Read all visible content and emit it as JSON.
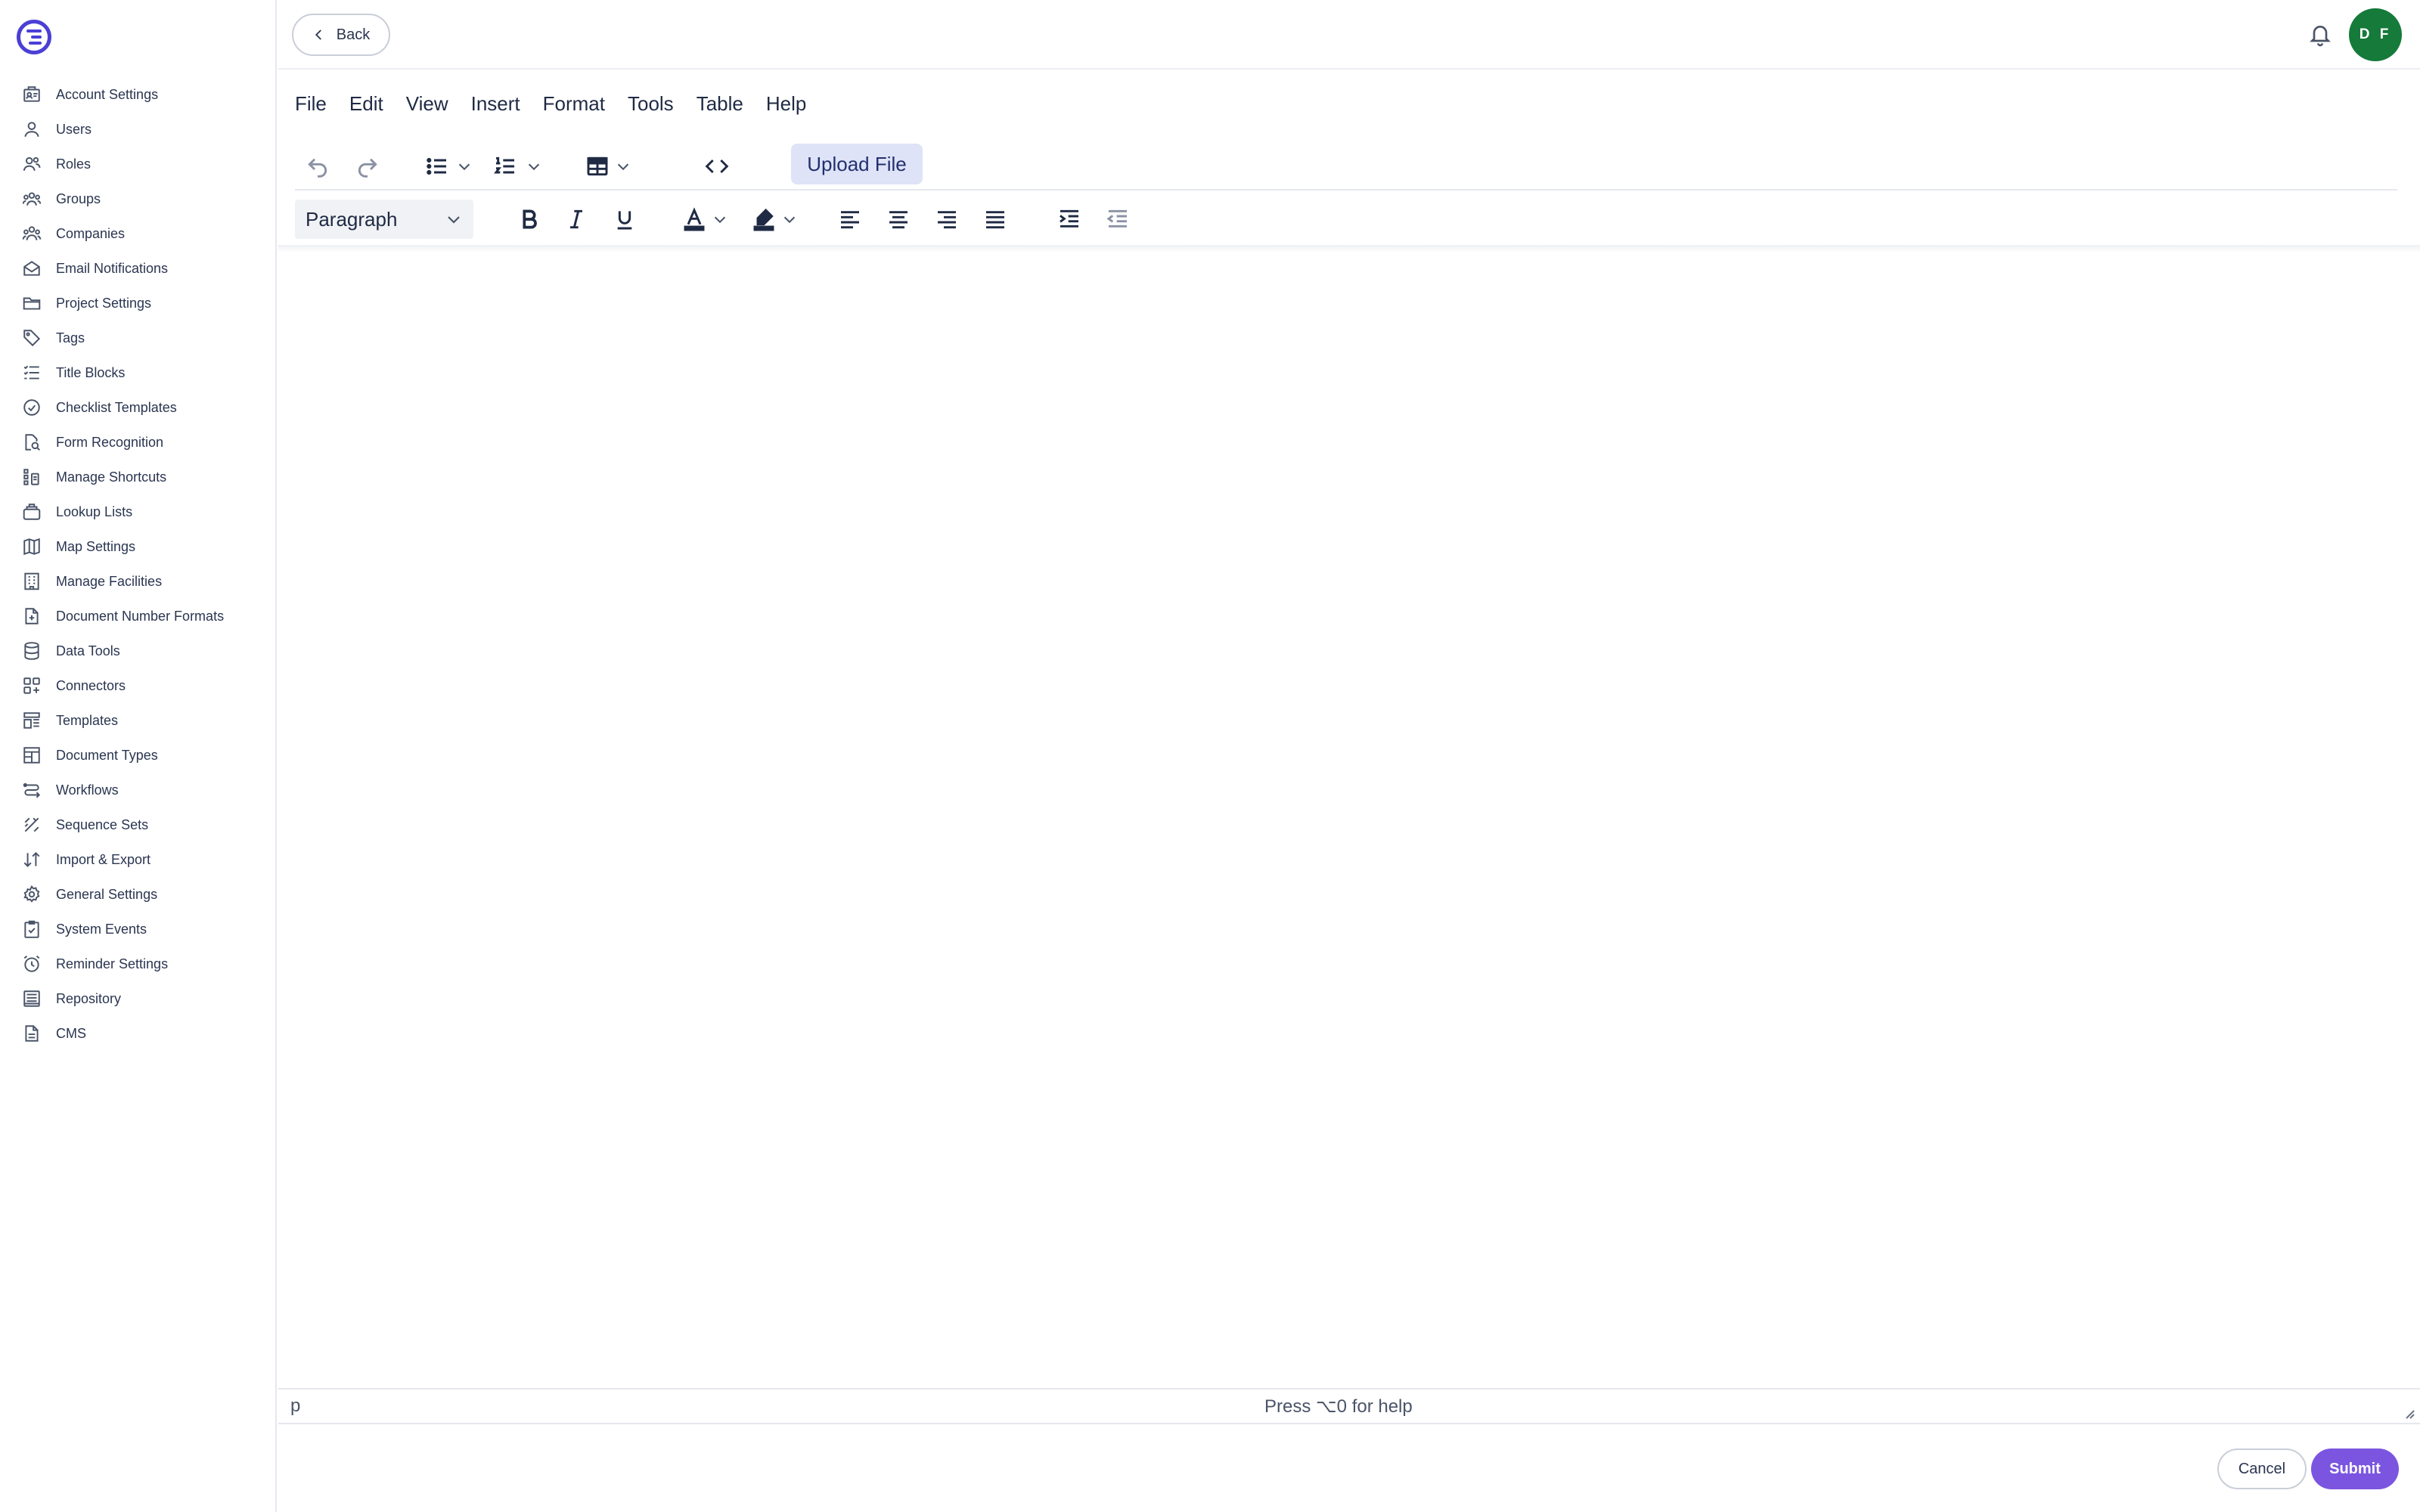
{
  "app": {
    "logo_icon": "app-logo-icon"
  },
  "sidebar": {
    "items": [
      {
        "label": "Account Settings",
        "icon": "account-settings-icon"
      },
      {
        "label": "Users",
        "icon": "user-icon"
      },
      {
        "label": "Roles",
        "icon": "roles-icon"
      },
      {
        "label": "Groups",
        "icon": "groups-icon"
      },
      {
        "label": "Companies",
        "icon": "companies-icon"
      },
      {
        "label": "Email Notifications",
        "icon": "envelope-icon"
      },
      {
        "label": "Project Settings",
        "icon": "folder-icon"
      },
      {
        "label": "Tags",
        "icon": "tag-icon"
      },
      {
        "label": "Title Blocks",
        "icon": "list-icon"
      },
      {
        "label": "Checklist Templates",
        "icon": "check-circle-icon"
      },
      {
        "label": "Form Recognition",
        "icon": "document-search-icon"
      },
      {
        "label": "Manage Shortcuts",
        "icon": "shortcut-icon"
      },
      {
        "label": "Lookup Lists",
        "icon": "lookup-icon"
      },
      {
        "label": "Map Settings",
        "icon": "map-icon"
      },
      {
        "label": "Manage Facilities",
        "icon": "building-icon"
      },
      {
        "label": "Document Number Formats",
        "icon": "document-plus-icon"
      },
      {
        "label": "Data Tools",
        "icon": "database-icon"
      },
      {
        "label": "Connectors",
        "icon": "grid-plus-icon"
      },
      {
        "label": "Templates",
        "icon": "template-icon"
      },
      {
        "label": "Document Types",
        "icon": "layout-icon"
      },
      {
        "label": "Workflows",
        "icon": "workflow-icon"
      },
      {
        "label": "Sequence Sets",
        "icon": "sequence-icon"
      },
      {
        "label": "Import & Export",
        "icon": "arrows-updown-icon"
      },
      {
        "label": "General Settings",
        "icon": "gear-icon"
      },
      {
        "label": "System Events",
        "icon": "clipboard-check-icon"
      },
      {
        "label": "Reminder Settings",
        "icon": "alarm-icon"
      },
      {
        "label": "Repository",
        "icon": "repository-icon"
      },
      {
        "label": "CMS",
        "icon": "file-icon"
      }
    ]
  },
  "header": {
    "back_label": "Back",
    "notifications_icon": "bell-icon",
    "avatar_initials": "D F",
    "avatar_color": "#157a3a"
  },
  "editor": {
    "menu": [
      "File",
      "Edit",
      "View",
      "Insert",
      "Format",
      "Tools",
      "Table",
      "Help"
    ],
    "upload_label": "Upload File",
    "block_format": "Paragraph",
    "status_path": "p",
    "status_help": "Press ⌥0 for help"
  },
  "footer": {
    "cancel_label": "Cancel",
    "submit_label": "Submit",
    "submit_color": "#7b55e0"
  }
}
